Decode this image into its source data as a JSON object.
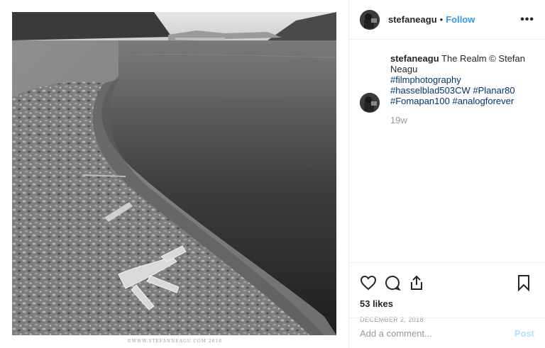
{
  "post": {
    "username": "stefaneagu",
    "follow_label": "Follow",
    "separator": "•",
    "more_icon": "more-horizontal-icon",
    "caption_user": "stefaneagu",
    "caption_text": "The Realm © Stefan Neagu",
    "hashtags": [
      "#filmphotography",
      "#hasselblad503CW",
      "#Planar80",
      "#Fomapan100",
      "#analogforever"
    ],
    "time_ago": "19w",
    "likes": "53 likes",
    "date": "DECEMBER 2, 2018"
  },
  "photo": {
    "watermark": "©WWW.STEFANNEAGU.COM 2018"
  },
  "actions": {
    "icons": [
      "heart-icon",
      "comment-icon",
      "share-icon",
      "bookmark-icon"
    ]
  },
  "add_comment": {
    "placeholder": "Add a comment...",
    "post_label": "Post"
  },
  "colors": {
    "link": "#3897f0",
    "hashtag": "#003569",
    "muted": "#999999",
    "post_disabled": "#b2dffc"
  }
}
